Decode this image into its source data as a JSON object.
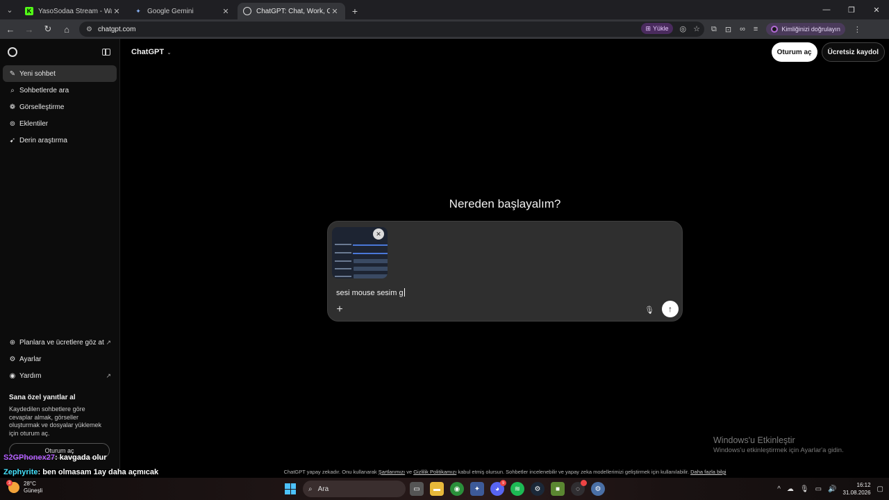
{
  "browser": {
    "tabs": [
      {
        "title": "YasoSodaa Stream - Watch Live",
        "favicon": "kick-icon",
        "color": "#53fc18"
      },
      {
        "title": "Google Gemini",
        "favicon": "gemini-icon",
        "color": "#8ab4f8"
      },
      {
        "title": "ChatGPT: Chat, Work, Create &",
        "favicon": "chatgpt-icon",
        "color": "#ffffff"
      }
    ],
    "url": "chatgpt.com",
    "install_label": "Yükle",
    "profile_label": "Kimliğinizi doğrulayın"
  },
  "sidebar": {
    "items": [
      {
        "label": "Yeni sohbet",
        "icon": "new-chat-icon"
      },
      {
        "label": "Sohbetlerde ara",
        "icon": "search-icon"
      },
      {
        "label": "Görselleştirme",
        "icon": "image-icon"
      },
      {
        "label": "Eklentiler",
        "icon": "plugin-icon"
      },
      {
        "label": "Derin araştırma",
        "icon": "telescope-icon"
      }
    ],
    "bottom_items": [
      {
        "label": "Planlara ve ücretlere göz at",
        "icon": "plans-icon"
      },
      {
        "label": "Ayarlar",
        "icon": "settings-icon"
      },
      {
        "label": "Yardım",
        "icon": "help-icon"
      }
    ],
    "promo_title": "Sana özel yanıtlar al",
    "promo_text": "Kaydedilen sohbetlere göre cevaplar almak, görseller oluşturmak ve dosyalar yüklemek için oturum aç.",
    "login_label": "Oturum aç"
  },
  "header": {
    "model": "ChatGPT",
    "login_button": "Oturum aç",
    "signup_button": "Ücretsiz kaydol"
  },
  "main": {
    "headline": "Nereden başlayalım?",
    "prompt_text": "sesi mouse sesim g"
  },
  "disclaimer": {
    "part1": "ChatGPT yapay zekadır. Onu kullanarak ",
    "terms": "Şartlarımızı",
    "part2": " ve ",
    "privacy": "Gizlilik Politikamızı",
    "part3": " kabul etmiş olursun. Sohbetler incelenebilir ve yapay zeka modellerimizi geliştirmek için kullanılabilir. ",
    "more": "Daha fazla bilgi"
  },
  "windows_activation": {
    "title": "Windows'u Etkinleştir",
    "subtitle": "Windows'u etkinleştirmek için Ayarlar'a gidin."
  },
  "stream_chat": [
    {
      "user": "S2GPhonex27",
      "message": ": kavgada olur"
    },
    {
      "user": "Zephyrite",
      "message": ": ben olmasam 1ay daha açmıcak"
    }
  ],
  "taskbar": {
    "temperature": "28°C",
    "weather": "Güneşli",
    "search_placeholder": "Ara",
    "time": "16:12",
    "date": "31.08.2026"
  }
}
